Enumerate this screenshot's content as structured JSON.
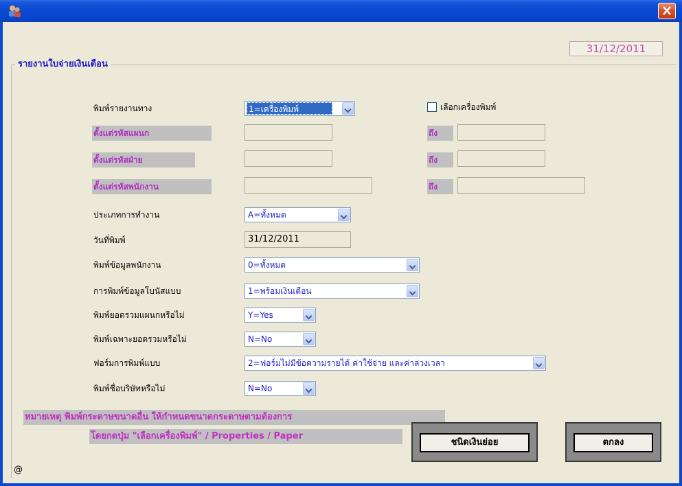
{
  "window": {
    "title": ""
  },
  "header": {
    "date": "31/12/2011"
  },
  "group_title": "รายงานใบจ่ายเงินเดือน",
  "form": {
    "print_to": {
      "label": "พิมพ์รายงานทาง",
      "value": "1=เครื่องพิมพ์"
    },
    "select_printer": {
      "label": "เลือกเครื่องพิมพ์",
      "checked": false
    },
    "dept_from": {
      "label": "ตั้งแต่รหัสแผนก",
      "to_label": "ถึง"
    },
    "div_from": {
      "label": "ตั้งแต่รหัสฝ่าย",
      "to_label": "ถึง"
    },
    "emp_from": {
      "label": "ตั้งแต่รหัสพนักงาน",
      "to_label": "ถึง"
    },
    "work_type": {
      "label": "ประเภทการทำงาน",
      "value": "A=ทั้งหมด"
    },
    "print_date": {
      "label": "วันที่พิมพ์",
      "value": "31/12/2011"
    },
    "emp_data": {
      "label": "พิมพ์ข้อมูลพนักงาน",
      "value": "0=ทั้งหมด"
    },
    "bonus": {
      "label": "การพิมพ์ข้อมูลโบนัสแบบ",
      "value": "1=พร้อมเงินเดือน"
    },
    "dept_total": {
      "label": "พิมพ์ยอดรวมแผนกหรือไม่",
      "value": "Y=Yes"
    },
    "total_only": {
      "label": "พิมพ์เฉพาะยอดรวมหรือไม่",
      "value": "N=No"
    },
    "form_type": {
      "label": "ฟอร์มการพิมพ์แบบ",
      "value": "2=ฟอร์มไม่มีข้อความรายได้ ค่าใช้จ่าย และค่าล่วงเวลา"
    },
    "company_name": {
      "label": "พิมพ์ชื่อบริษัทหรือไม่",
      "value": "N=No"
    }
  },
  "note": {
    "line1": "หมายเหตุ  พิมพ์กระดาษขนาดอื่น ให้กำหนดขนาดกระดาษตามต้องการ",
    "line2": "โดยกดปุ่ม \"เลือกเครื่องพิมพ์\" / Properties / Paper"
  },
  "buttons": {
    "coin_type": "ชนิดเงินย่อย",
    "ok": "ตกลง"
  },
  "footer": {
    "at": "@"
  },
  "colors": {
    "titlebar": "#0a4ad1",
    "label_purple": "#b030c0",
    "combo_text": "#1c1cc4"
  }
}
